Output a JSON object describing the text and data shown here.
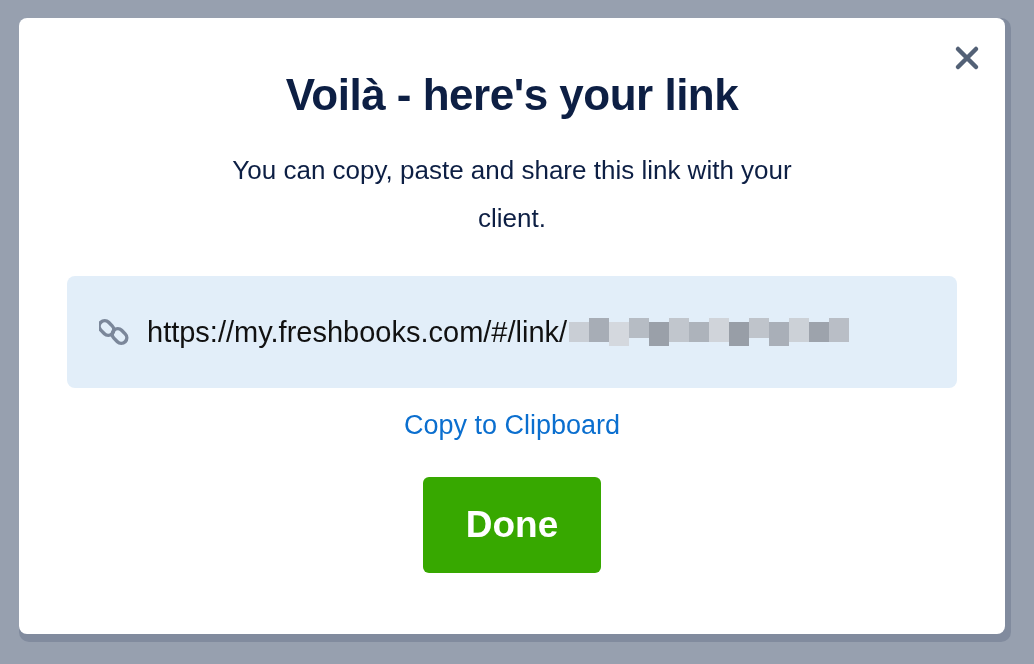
{
  "dialog": {
    "title": "Voilà - here's your link",
    "message": "You can copy, paste and share this link with your client.",
    "link": {
      "url": "https://my.freshbooks.com/#/link/",
      "redacted": true
    },
    "copy_link": "Copy to Clipboard",
    "buttons": [
      {
        "label": "Done",
        "kind": "primary"
      }
    ]
  }
}
